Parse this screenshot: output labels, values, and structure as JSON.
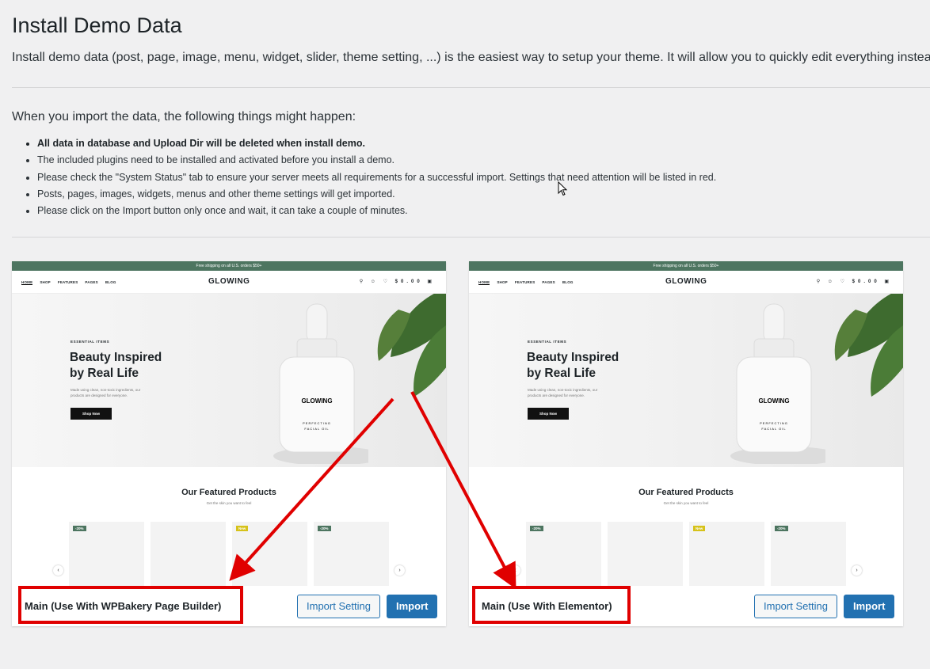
{
  "header": {
    "title": "Install Demo Data",
    "intro": "Install demo data (post, page, image, menu, widget, slider, theme setting, ...) is the easiest way to setup your theme. It will allow you to quickly edit everything instea"
  },
  "notice": {
    "lead": "When you import the data, the following things might happen:",
    "items": [
      "All data in database and Upload Dir will be deleted when install demo.",
      "The included plugins need to be installed and activated before you install a demo.",
      "Please check the \"System Status\" tab to ensure your server meets all requirements for a successful import. Settings that need attention will be listed in red.",
      "Posts, pages, images, widgets, menus and other theme settings will get imported.",
      "Please click on the Import button only once and wait, it can take a couple of minutes."
    ]
  },
  "preview": {
    "topbar": "Free shipping on all U.S. orders $50+",
    "nav": [
      "HOME",
      "SHOP",
      "FEATURES",
      "PAGES",
      "BLOG"
    ],
    "logo": "GLOWING",
    "cart_total": "$0.00",
    "eyebrow": "ESSENTIAL ITEMS",
    "headline_1": "Beauty Inspired",
    "headline_2": "by Real Life",
    "subtext": "Made using clean, non-toxic ingredients, our products are designed for everyone.",
    "cta": "Shop Now",
    "bottle_brand": "GLOWING",
    "bottle_caption_1": "PERFECTING",
    "bottle_caption_2": "FACIAL OIL",
    "featured_title": "Our Featured Products",
    "featured_sub": "Get the skin you want to feel",
    "tags": [
      "-20%",
      "",
      "New",
      "-20%"
    ],
    "tag_colors": [
      "#4d7560",
      "",
      "#d6c21a",
      "#4d7560"
    ]
  },
  "demos": [
    {
      "name": "Main (Use With WPBakery Page Builder)",
      "import_setting": "Import Setting",
      "import": "Import"
    },
    {
      "name": "Main (Use With Elementor)",
      "import_setting": "Import Setting",
      "import": "Import"
    }
  ],
  "colors": {
    "accent": "#2271b1",
    "highlight": "#e00000"
  }
}
